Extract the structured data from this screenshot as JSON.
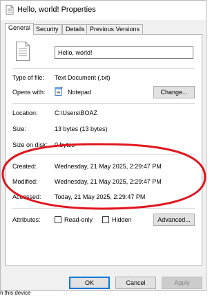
{
  "window": {
    "title": "Hello, world! Properties",
    "tabs": [
      {
        "label": "General"
      },
      {
        "label": "Security"
      },
      {
        "label": "Details"
      },
      {
        "label": "Previous Versions"
      }
    ]
  },
  "general": {
    "file_name": "Hello, world!",
    "type_label": "Type of file:",
    "type_value": "Text Document (.txt)",
    "opens_label": "Opens with:",
    "opens_value": "Notepad",
    "change_button": "Change...",
    "location_label": "Location:",
    "location_value": "C:\\Users\\BOAZ",
    "size_label": "Size:",
    "size_value": "13 bytes (13 bytes)",
    "size_disk_label": "Size on disk:",
    "size_disk_value": "0 bytes",
    "created_label": "Created:",
    "created_value": "Wednesday, 21 May 2025, 2:29:47 PM",
    "modified_label": "Modified:",
    "modified_value": "Wednesday, 21 May 2025, 2:29:47 PM",
    "accessed_label": "Accessed:",
    "accessed_value": "Today, 21 May 2025, 2:29:47 PM",
    "attributes_label": "Attributes:",
    "readonly_label": "Read-only",
    "hidden_label": "Hidden",
    "advanced_button": "Advanced..."
  },
  "footer": {
    "ok": "OK",
    "cancel": "Cancel",
    "apply": "Apply"
  },
  "background": {
    "text": "n this device"
  },
  "colors": {
    "annotation": "#e0161f",
    "dialog_bg": "#f0f0f0",
    "focus_border": "#0078d7"
  }
}
